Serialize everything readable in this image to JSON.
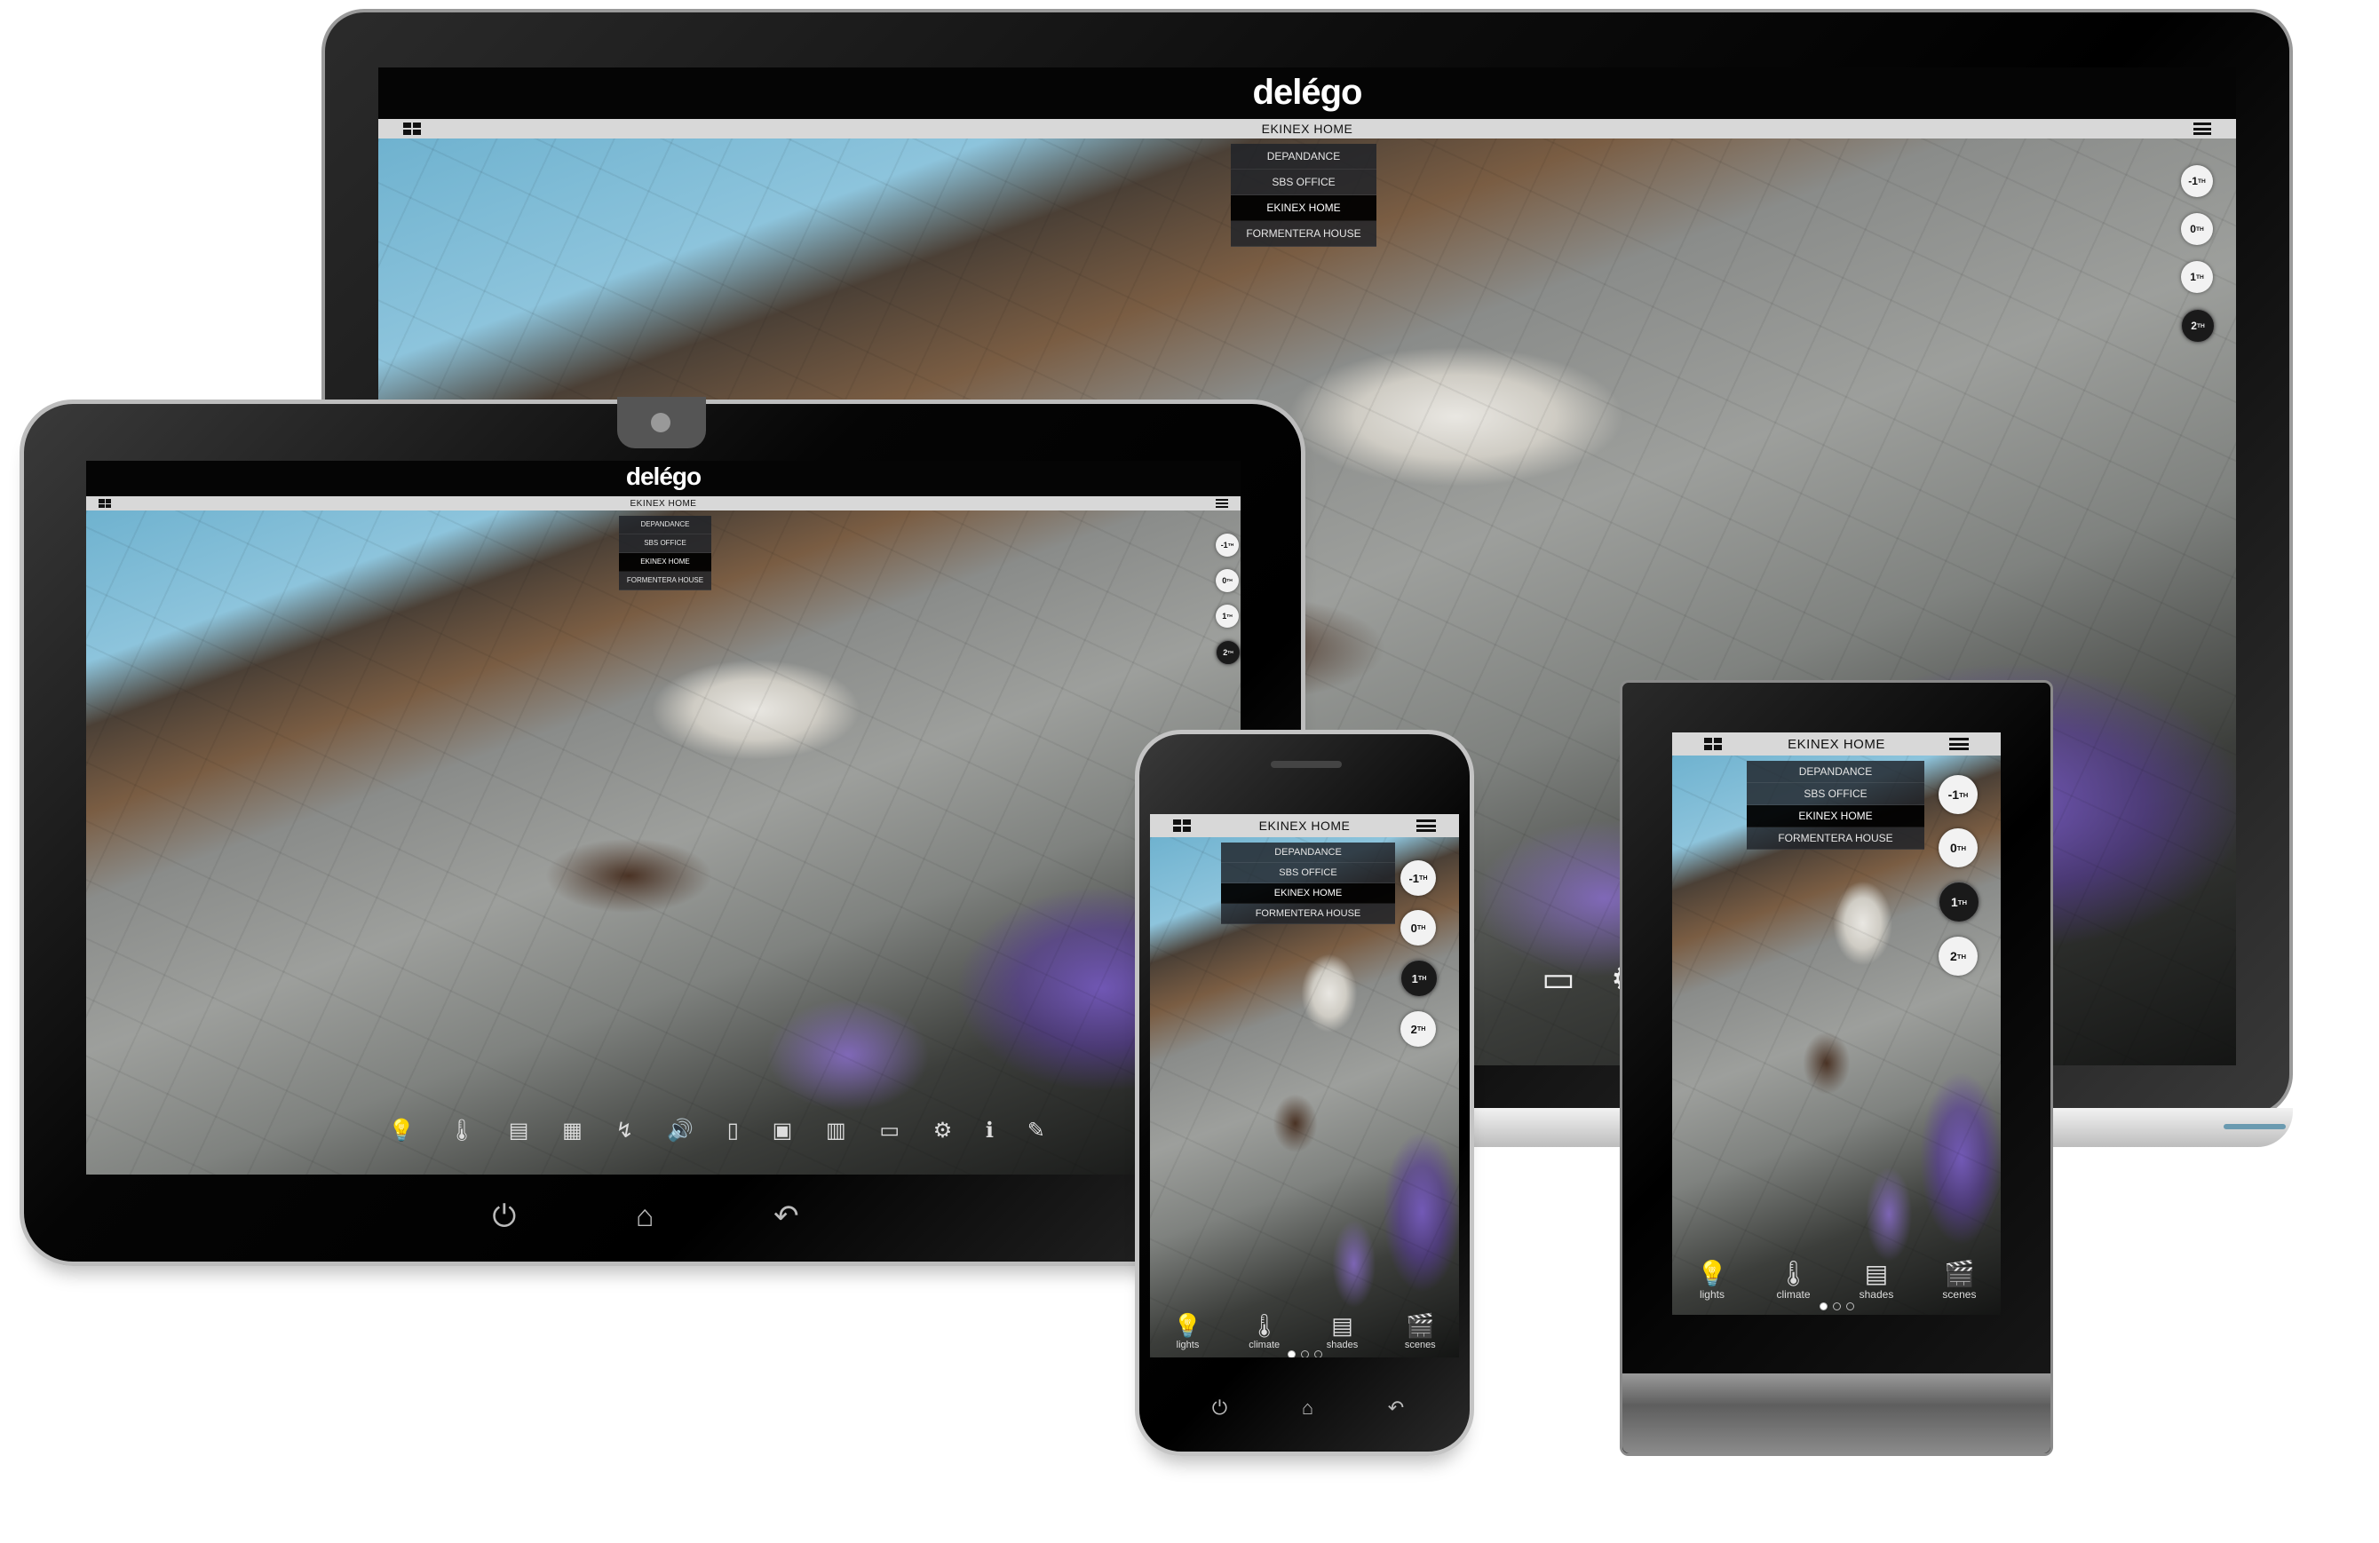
{
  "brand": "delégo",
  "home_title": "EKINEX HOME",
  "sites": [
    "DEPANDANCE",
    "SBS OFFICE",
    "EKINEX HOME",
    "FORMENTERA HOUSE"
  ],
  "selected_site_index": 2,
  "floors": [
    {
      "num": "-1",
      "suffix": "TH"
    },
    {
      "num": "0",
      "suffix": "TH"
    },
    {
      "num": "1",
      "suffix": "TH"
    },
    {
      "num": "2",
      "suffix": "TH"
    }
  ],
  "dock_items": [
    {
      "label": "lights",
      "icon": "bulb-icon",
      "glyph": "💡"
    },
    {
      "label": "climate",
      "icon": "thermometer-icon",
      "glyph": "🌡"
    },
    {
      "label": "shades",
      "icon": "shades-icon",
      "glyph": "▤"
    },
    {
      "label": "scenes",
      "icon": "scenes-icon",
      "glyph": "🎬"
    }
  ],
  "tablet_toolbar_icons": [
    {
      "icon": "bulb-icon",
      "glyph": "💡"
    },
    {
      "icon": "thermometer-icon",
      "glyph": "🌡"
    },
    {
      "icon": "shades-icon",
      "glyph": "▤"
    },
    {
      "icon": "scenes-icon",
      "glyph": "▦"
    },
    {
      "icon": "energy-icon",
      "glyph": "↯"
    },
    {
      "icon": "audio-icon",
      "glyph": "🔊"
    },
    {
      "icon": "door-icon",
      "glyph": "▯"
    },
    {
      "icon": "cctv-icon",
      "glyph": "▣"
    },
    {
      "icon": "chart-icon",
      "glyph": "▥"
    },
    {
      "icon": "blind-icon",
      "glyph": "▭"
    },
    {
      "icon": "settings-gear-icon",
      "glyph": "⚙"
    },
    {
      "icon": "info-icon",
      "glyph": "ℹ"
    },
    {
      "icon": "tools-icon",
      "glyph": "✎"
    }
  ],
  "laptop_side_icons": [
    {
      "icon": "blind-icon",
      "glyph": "▭"
    },
    {
      "icon": "settings-gear-icon",
      "glyph": "⚙"
    }
  ],
  "android_nav": [
    {
      "icon": "power-icon",
      "glyph": "⏻"
    },
    {
      "icon": "home-icon",
      "glyph": "⌂"
    },
    {
      "icon": "back-icon",
      "glyph": "↶"
    }
  ]
}
